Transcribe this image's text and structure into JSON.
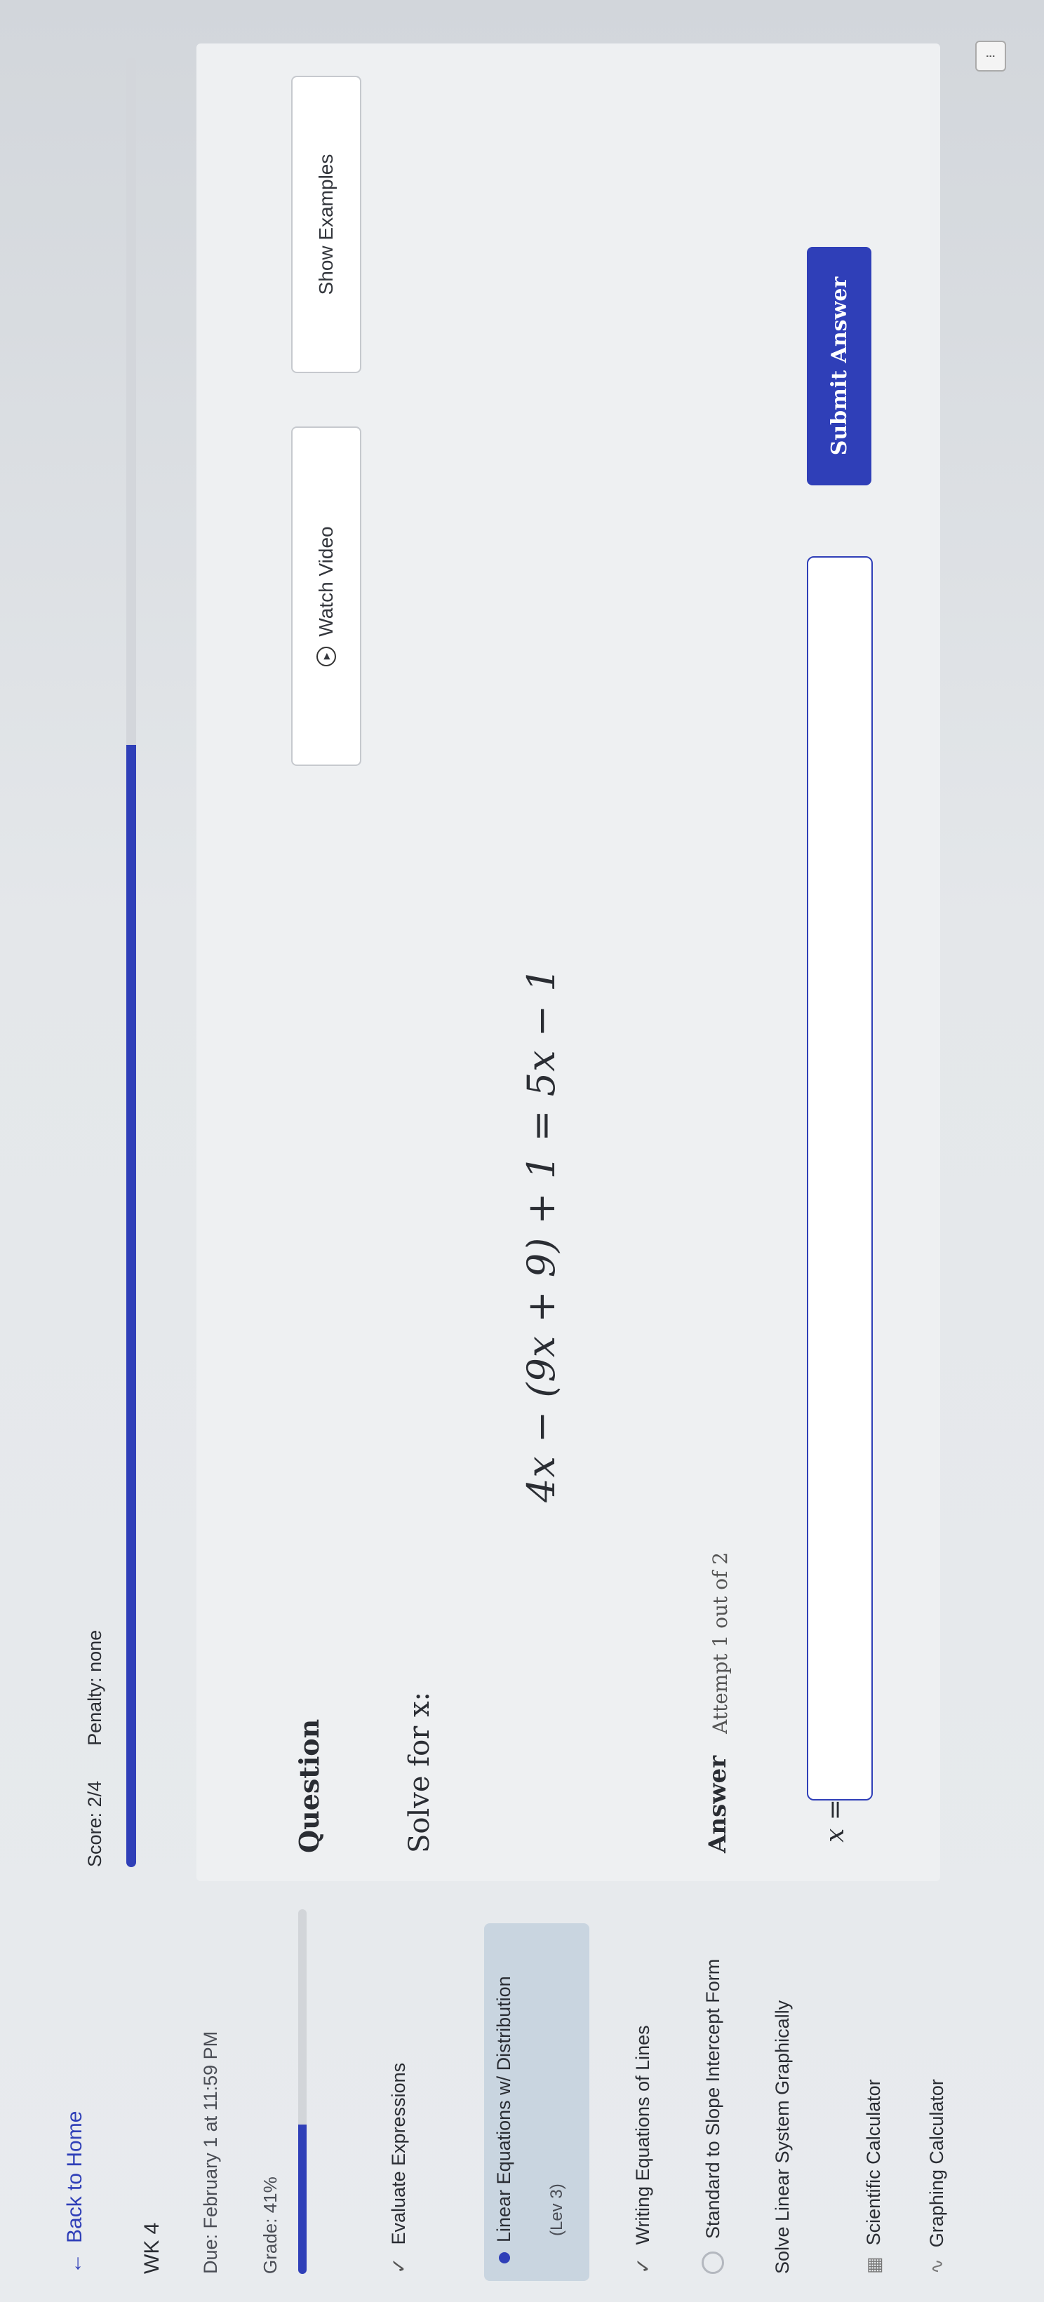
{
  "sidebar": {
    "back_label": "Back to Home",
    "assignment": "WK 4",
    "due": "Due: February 1 at 11:59 PM",
    "grade": "Grade: 41%",
    "grade_fraction": 0.41,
    "topics": {
      "evaluate": "Evaluate Expressions",
      "linear_title": "Linear Equations w/ Distribution",
      "linear_level": "(Lev 3)",
      "writing": "Writing Equations of Lines",
      "standard": "Standard to Slope Intercept Form",
      "solve_linear": "Solve Linear System Graphically"
    },
    "tools": {
      "scientific": "Scientific Calculator",
      "graphing": "Graphing Calculator"
    }
  },
  "header": {
    "score": "Score: 2/4",
    "penalty": "Penalty: none",
    "progress_fraction": 0.62
  },
  "question": {
    "label": "Question",
    "watch_video": "Watch Video",
    "show_examples": "Show Examples",
    "prompt": "Solve for x:",
    "equation": "4x − (9x + 9) + 1 = 5x − 1"
  },
  "answer": {
    "label": "Answer",
    "attempt": "Attempt 1 out of 2",
    "variable_label": "x =",
    "value": "",
    "submit": "Submit Answer"
  },
  "colors": {
    "accent": "#2f3fb8",
    "active_topic_bg": "#c9d5e0"
  }
}
